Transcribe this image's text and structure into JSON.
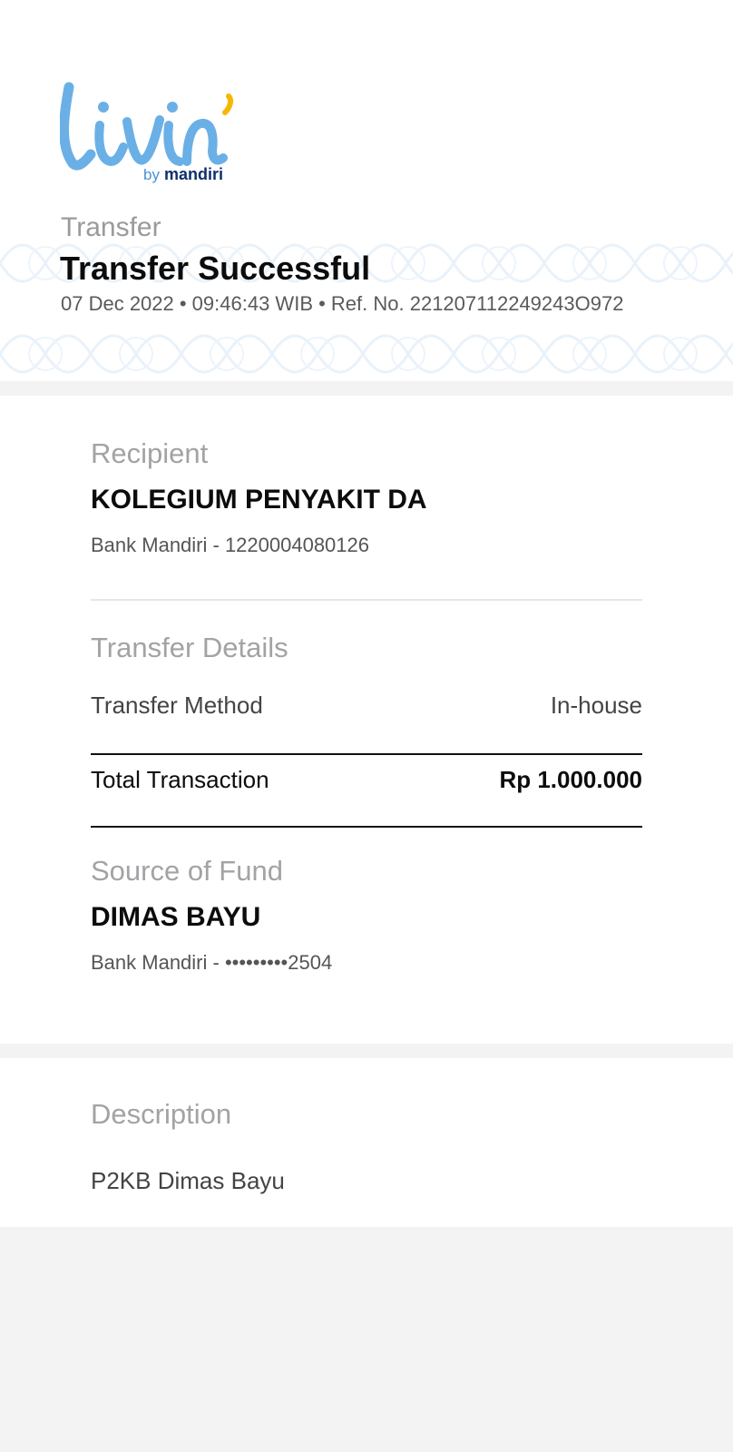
{
  "brand": {
    "logo_text": "livin'",
    "by_text": "by",
    "bank_text": "mandiri",
    "logo_color": "#6ab0e6",
    "accent_color": "#f5b800",
    "bank_color": "#0d2f6d"
  },
  "header": {
    "category": "Transfer",
    "title": "Transfer Successful",
    "meta": "07 Dec 2022 • 09:46:43 WIB • Ref. No. 221207112249243O972"
  },
  "recipient": {
    "label": "Recipient",
    "name": "KOLEGIUM PENYAKIT DA",
    "account": "Bank Mandiri - 1220004080126"
  },
  "transfer_details": {
    "label": "Transfer Details",
    "method_label": "Transfer Method",
    "method_value": "In-house",
    "total_label": "Total Transaction",
    "total_value": "Rp 1.000.000"
  },
  "source_of_fund": {
    "label": "Source of Fund",
    "name": "DIMAS BAYU",
    "account": "Bank Mandiri - •••••••••2504"
  },
  "description": {
    "label": "Description",
    "text": "P2KB Dimas Bayu"
  }
}
